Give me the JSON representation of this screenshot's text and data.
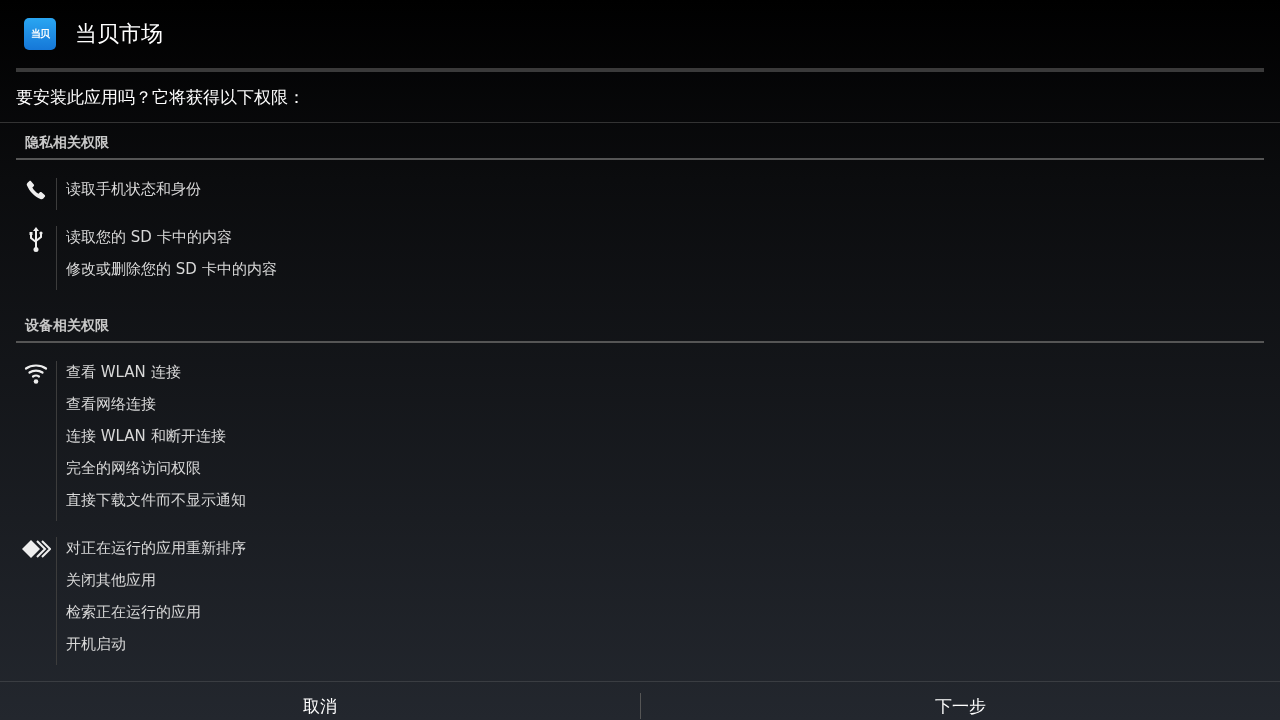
{
  "window": {
    "title": "当贝市场",
    "logo_text": "当贝"
  },
  "prompt": "要安装此应用吗？它将获得以下权限：",
  "sections": [
    {
      "title": "隐私相关权限",
      "groups": [
        {
          "kind": "phone",
          "items": [
            "读取手机状态和身份"
          ]
        },
        {
          "kind": "usb",
          "items": [
            "读取您的 SD 卡中的内容",
            "修改或删除您的 SD 卡中的内容"
          ]
        }
      ]
    },
    {
      "title": "设备相关权限",
      "groups": [
        {
          "kind": "wifi",
          "items": [
            "查看 WLAN 连接",
            "查看网络连接",
            "连接 WLAN 和断开连接",
            "完全的网络访问权限",
            "直接下载文件而不显示通知"
          ]
        },
        {
          "kind": "apps",
          "items": [
            "对正在运行的应用重新排序",
            "关闭其他应用",
            "检索正在运行的应用",
            "开机启动"
          ]
        }
      ]
    }
  ],
  "buttons": [
    "取消",
    "下一步"
  ]
}
